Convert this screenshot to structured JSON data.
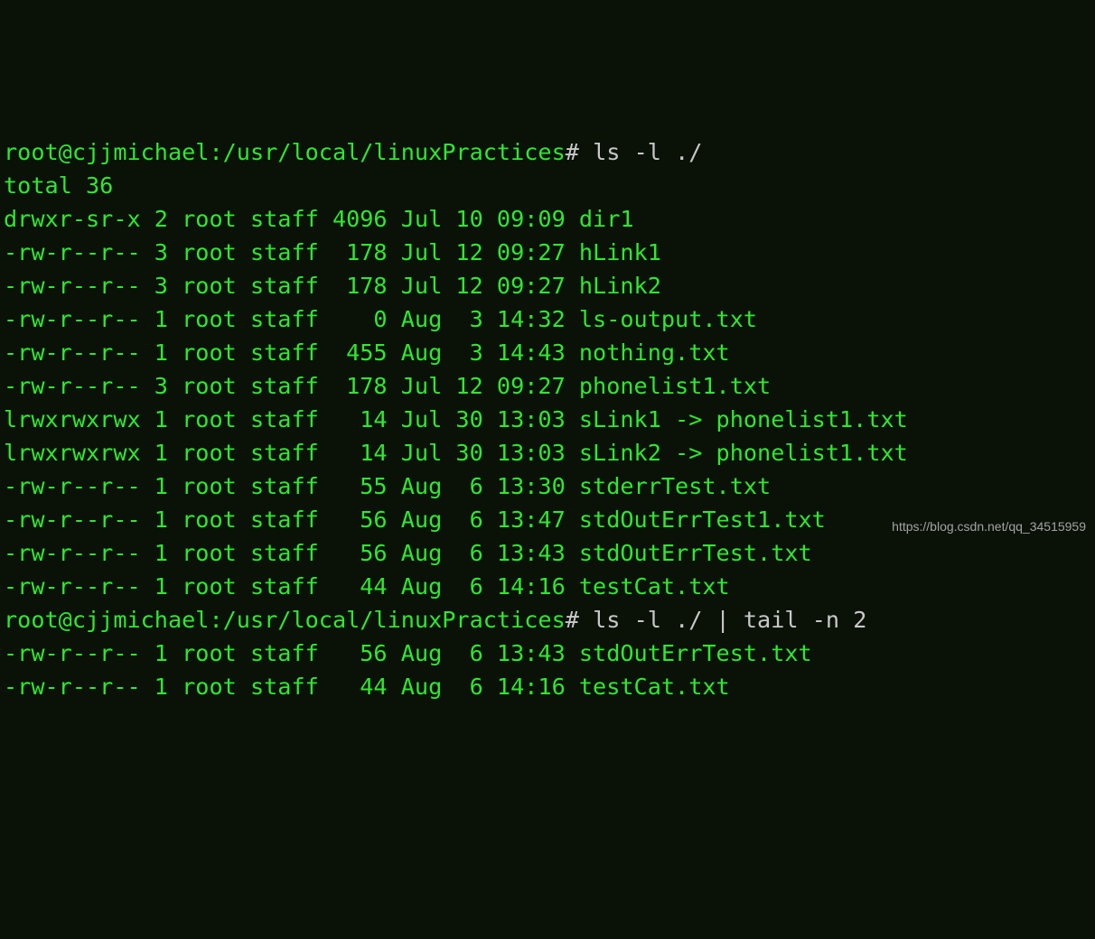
{
  "prompt1": {
    "user_host_path": "root@cjjmichael:/usr/local/linuxPractices",
    "hash": "#",
    "command": "ls -l ./"
  },
  "total_line": "total 36",
  "listing1": [
    "drwxr-sr-x 2 root staff 4096 Jul 10 09:09 dir1",
    "-rw-r--r-- 3 root staff  178 Jul 12 09:27 hLink1",
    "-rw-r--r-- 3 root staff  178 Jul 12 09:27 hLink2",
    "-rw-r--r-- 1 root staff    0 Aug  3 14:32 ls-output.txt",
    "-rw-r--r-- 1 root staff  455 Aug  3 14:43 nothing.txt",
    "-rw-r--r-- 3 root staff  178 Jul 12 09:27 phonelist1.txt",
    "lrwxrwxrwx 1 root staff   14 Jul 30 13:03 sLink1 -> phonelist1.txt",
    "lrwxrwxrwx 1 root staff   14 Jul 30 13:03 sLink2 -> phonelist1.txt",
    "-rw-r--r-- 1 root staff   55 Aug  6 13:30 stderrTest.txt",
    "-rw-r--r-- 1 root staff   56 Aug  6 13:47 stdOutErrTest1.txt",
    "-rw-r--r-- 1 root staff   56 Aug  6 13:43 stdOutErrTest.txt",
    "-rw-r--r-- 1 root staff   44 Aug  6 14:16 testCat.txt"
  ],
  "prompt2": {
    "user_host_path": "root@cjjmichael:/usr/local/linuxPractices",
    "hash": "#",
    "command": "ls -l ./ | tail -n 2"
  },
  "listing2": [
    "-rw-r--r-- 1 root staff   56 Aug  6 13:43 stdOutErrTest.txt",
    "-rw-r--r-- 1 root staff   44 Aug  6 14:16 testCat.txt"
  ],
  "watermark": "https://blog.csdn.net/qq_34515959"
}
